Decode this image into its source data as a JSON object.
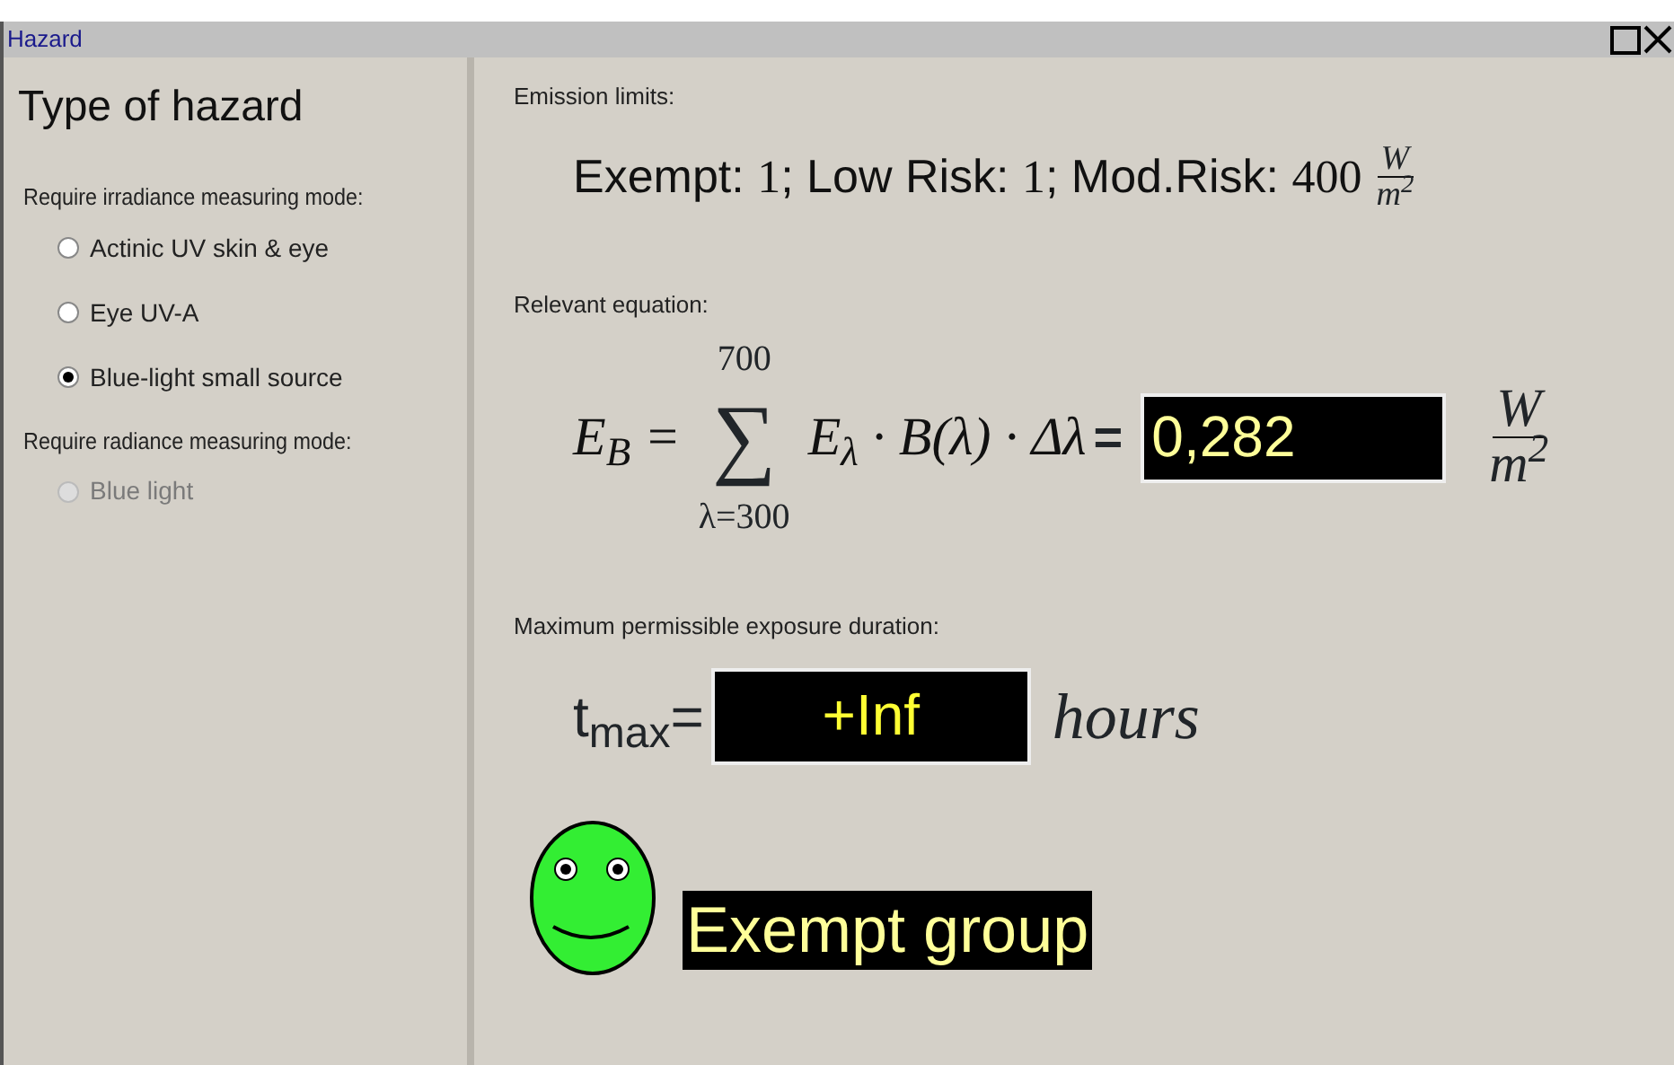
{
  "window": {
    "title": "Hazard"
  },
  "left_panel": {
    "title": "Type of hazard",
    "groups": [
      {
        "label": "Require irradiance measuring mode:",
        "options": [
          {
            "label": "Actinic UV skin & eye",
            "selected": false,
            "disabled": false
          },
          {
            "label": "Eye UV-A",
            "selected": false,
            "disabled": false
          },
          {
            "label": "Blue-light small source",
            "selected": true,
            "disabled": false
          }
        ]
      },
      {
        "label": "Require radiance measuring mode:",
        "options": [
          {
            "label": "Blue light",
            "selected": false,
            "disabled": true
          }
        ]
      }
    ]
  },
  "emission": {
    "label": "Emission limits:",
    "parts": [
      {
        "kind": "text",
        "text": "Exempt: "
      },
      {
        "kind": "math",
        "text": "1"
      },
      {
        "kind": "text",
        "text": "; Low Risk: "
      },
      {
        "kind": "math",
        "text": "1"
      },
      {
        "kind": "text",
        "text": "; Mod.Risk: "
      },
      {
        "kind": "math",
        "text": "400"
      }
    ],
    "unit": {
      "numerator": "W",
      "denominator": "m$^{2}$"
    }
  },
  "equation": {
    "label": "Relevant equation:",
    "lhs": "E$_{B}$ =",
    "sum_symbol": "∑",
    "upper": "700",
    "lower": "λ=300",
    "body": "E$_{λ}$ · B(λ) · Δλ",
    "equals": "=",
    "value": "0,282",
    "unit": {
      "numerator": "W",
      "denominator": "m$^{2}$"
    }
  },
  "exposure": {
    "label": "Maximum permissible exposure duration:",
    "symbol": "t$_{max}$=",
    "value": "+Inf",
    "unit": "hours"
  },
  "result": {
    "color": "#33ee33",
    "text": "Exempt group"
  }
}
